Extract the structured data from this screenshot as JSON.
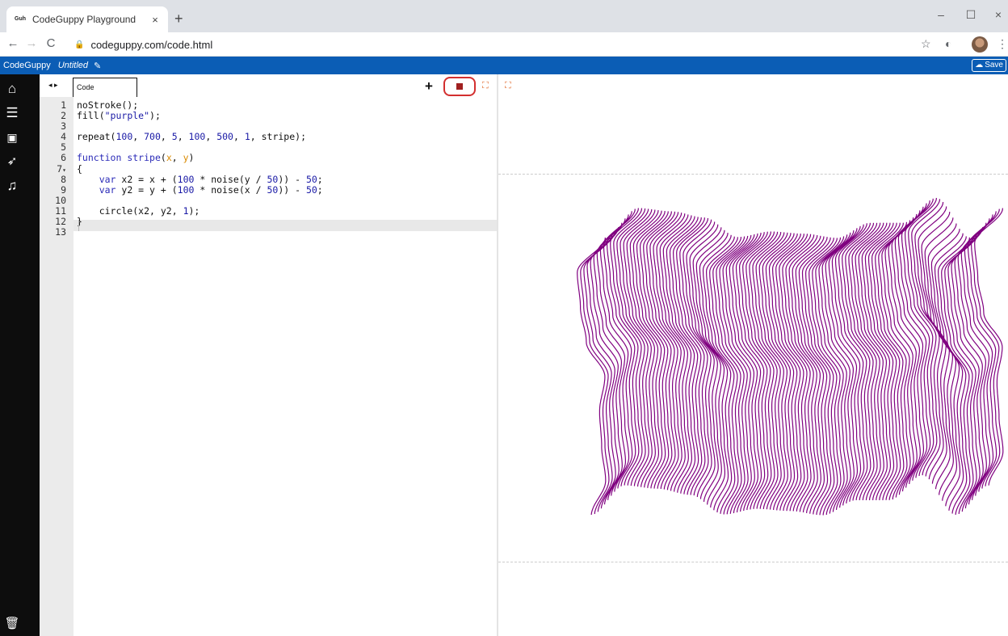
{
  "browser": {
    "tab_title": "CodeGuppy Playground",
    "favicon_text": "Guh",
    "tab_close": "×",
    "new_tab": "+",
    "url": "codeguppy.com/code.html",
    "window_controls": [
      "–",
      "☐",
      "×"
    ]
  },
  "appbar": {
    "app_name": "CodeGuppy",
    "project_name": "Untitled",
    "save_label": "Save"
  },
  "editor": {
    "tab_label": "Code",
    "line_numbers": [
      "1",
      "2",
      "3",
      "4",
      "5",
      "6",
      "7",
      "8",
      "9",
      "10",
      "11",
      "12",
      "13"
    ],
    "lines": [
      "noStroke();",
      "fill(\"purple\");",
      "",
      "repeat(100, 700, 5, 100, 500, 1, stripe);",
      "",
      "function stripe(x, y)",
      "{",
      "    var x2 = x + (100 * noise(y / 50)) - 50;",
      "    var y2 = y + (100 * noise(x / 50)) - 50;",
      "",
      "    circle(x2, y2, 1);",
      "}",
      ""
    ],
    "active_line": 11
  },
  "output": {
    "fill_color": "#800080"
  },
  "icons": {
    "sidebar": [
      "home-icon",
      "menu-icon",
      "image-icon",
      "rocket-icon",
      "music-icon",
      "trash-icon"
    ]
  }
}
